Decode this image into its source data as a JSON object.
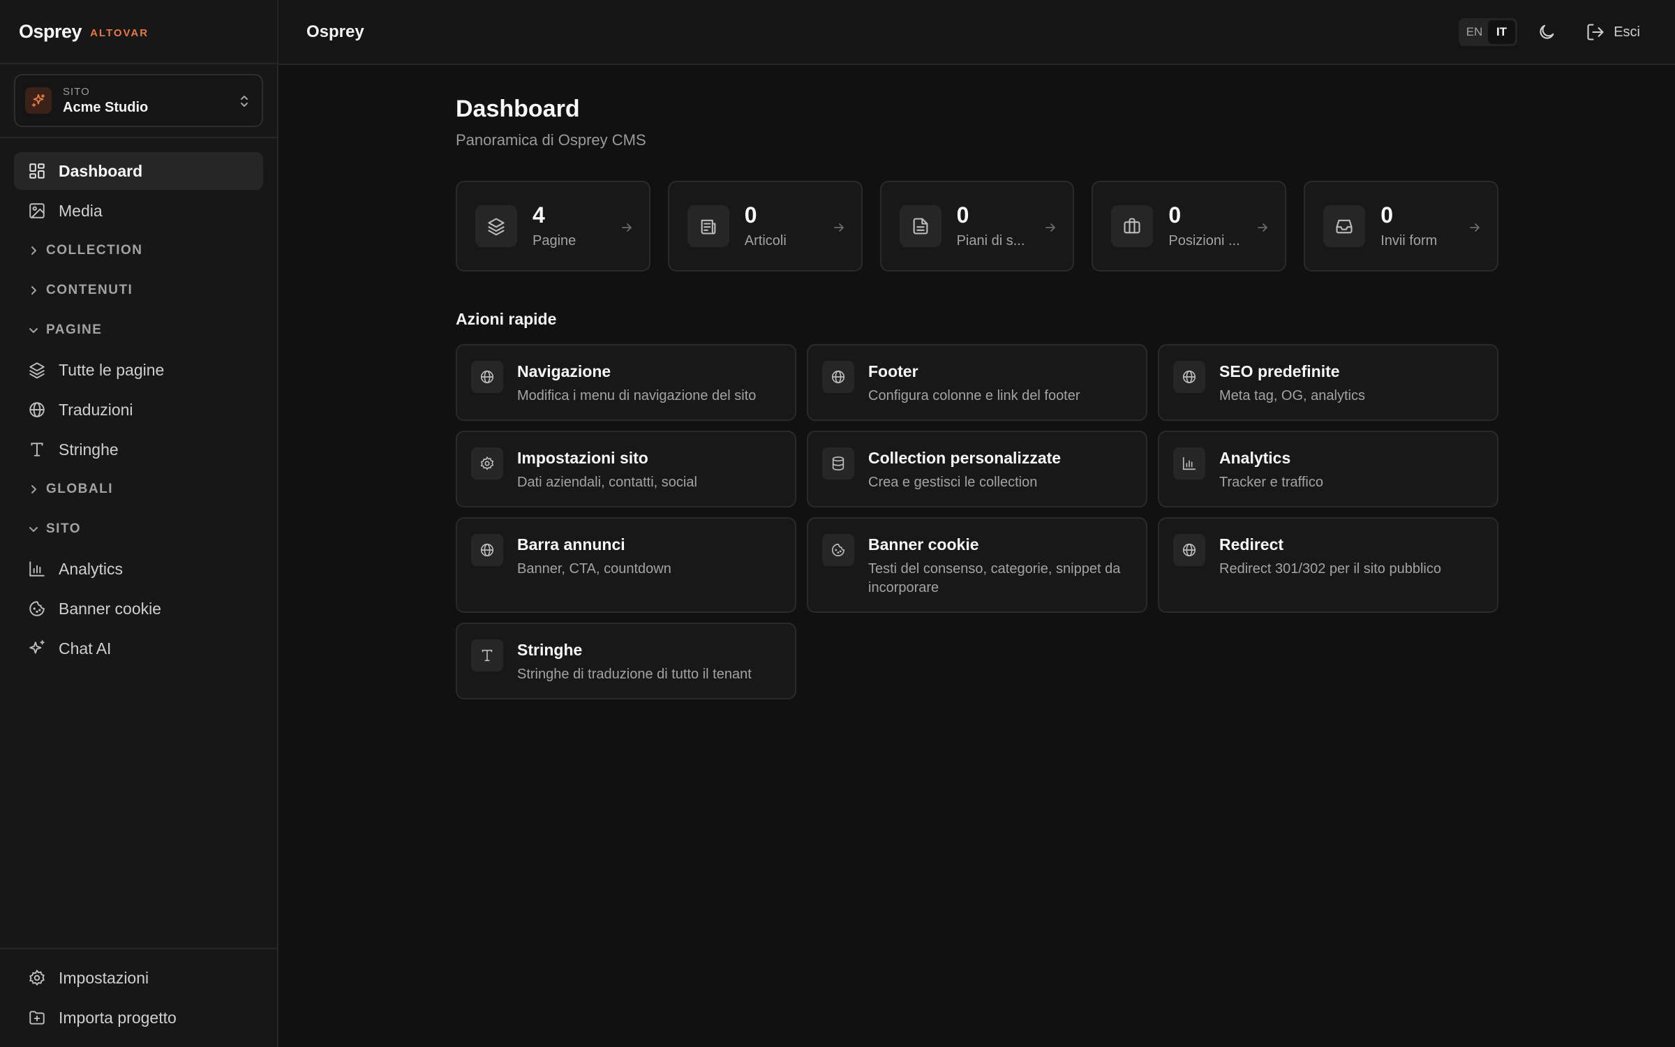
{
  "brand": {
    "name": "Osprey",
    "tag": "ALTOVAR",
    "accent_color": "#ea7a3a"
  },
  "site_switcher": {
    "label": "SITO",
    "name": "Acme Studio",
    "icon": "sparkles-icon"
  },
  "sidebar": {
    "items": [
      {
        "label": "Dashboard",
        "icon": "dashboard-icon",
        "active": true
      },
      {
        "label": "Media",
        "icon": "image-icon"
      }
    ],
    "groups": {
      "collection": {
        "label": "COLLECTION",
        "expanded": false
      },
      "contenuti": {
        "label": "CONTENUTI",
        "expanded": false
      },
      "pagine": {
        "label": "PAGINE",
        "expanded": true,
        "items": [
          {
            "label": "Tutte le pagine",
            "icon": "layers-icon"
          },
          {
            "label": "Traduzioni",
            "icon": "globe-icon"
          },
          {
            "label": "Stringhe",
            "icon": "type-icon"
          }
        ]
      },
      "globali": {
        "label": "GLOBALI",
        "expanded": false
      },
      "sito": {
        "label": "SITO",
        "expanded": true,
        "items": [
          {
            "label": "Analytics",
            "icon": "bar-chart-icon"
          },
          {
            "label": "Banner cookie",
            "icon": "cookie-icon"
          },
          {
            "label": "Chat AI",
            "icon": "sparkles-icon"
          }
        ]
      }
    },
    "bottom": [
      {
        "label": "Impostazioni",
        "icon": "gear-icon"
      },
      {
        "label": "Importa progetto",
        "icon": "folder-plus-icon"
      }
    ]
  },
  "header": {
    "title": "Osprey",
    "lang": {
      "en": "EN",
      "it": "IT",
      "selected": "IT"
    },
    "theme_icon": "moon-icon",
    "logout_label": "Esci"
  },
  "main": {
    "title": "Dashboard",
    "subtitle": "Panoramica di Osprey CMS",
    "stats": [
      {
        "value": "4",
        "label": "Pagine",
        "icon": "layers-icon"
      },
      {
        "value": "0",
        "label": "Articoli",
        "icon": "newspaper-icon"
      },
      {
        "value": "0",
        "label": "Piani di s...",
        "icon": "file-text-icon"
      },
      {
        "value": "0",
        "label": "Posizioni ...",
        "icon": "briefcase-icon"
      },
      {
        "value": "0",
        "label": "Invii form",
        "icon": "inbox-icon"
      }
    ],
    "quick_actions_title": "Azioni rapide",
    "actions": [
      {
        "title": "Navigazione",
        "desc": "Modifica i menu di navigazione del sito",
        "icon": "globe-icon"
      },
      {
        "title": "Footer",
        "desc": "Configura colonne e link del footer",
        "icon": "globe-icon"
      },
      {
        "title": "SEO predefinite",
        "desc": "Meta tag, OG, analytics",
        "icon": "globe-icon"
      },
      {
        "title": "Impostazioni sito",
        "desc": "Dati aziendali, contatti, social",
        "icon": "gear-icon"
      },
      {
        "title": "Collection personalizzate",
        "desc": "Crea e gestisci le collection",
        "icon": "database-icon"
      },
      {
        "title": "Analytics",
        "desc": "Tracker e traffico",
        "icon": "bar-chart-icon"
      },
      {
        "title": "Barra annunci",
        "desc": "Banner, CTA, countdown",
        "icon": "globe-icon"
      },
      {
        "title": "Banner cookie",
        "desc": "Testi del consenso, categorie, snippet da incorporare",
        "icon": "cookie-icon"
      },
      {
        "title": "Redirect",
        "desc": "Redirect 301/302 per il sito pubblico",
        "icon": "globe-icon"
      },
      {
        "title": "Stringhe",
        "desc": "Stringhe di traduzione di tutto il tenant",
        "icon": "type-icon"
      }
    ]
  }
}
